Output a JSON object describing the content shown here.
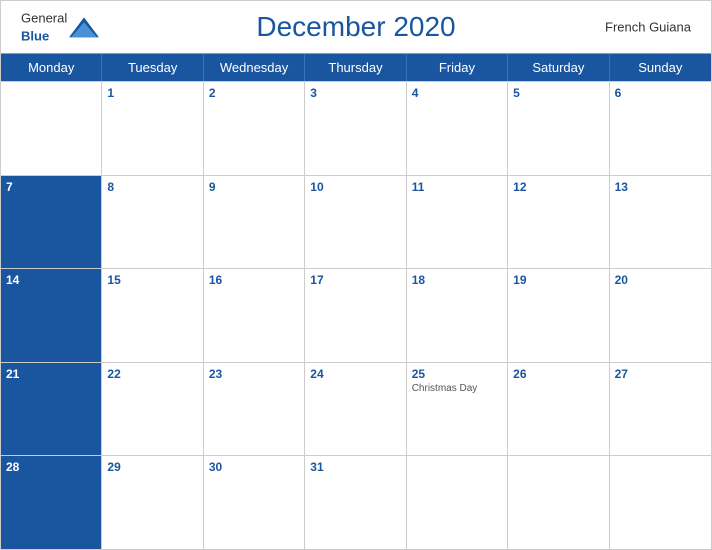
{
  "header": {
    "logo_general": "General",
    "logo_blue": "Blue",
    "title": "December 2020",
    "region": "French Guiana"
  },
  "dayHeaders": [
    "Monday",
    "Tuesday",
    "Wednesday",
    "Thursday",
    "Friday",
    "Saturday",
    "Sunday"
  ],
  "weeks": [
    [
      {
        "num": "",
        "empty": true
      },
      {
        "num": "1"
      },
      {
        "num": "2"
      },
      {
        "num": "3"
      },
      {
        "num": "4"
      },
      {
        "num": "5"
      },
      {
        "num": "6"
      }
    ],
    [
      {
        "num": "7"
      },
      {
        "num": "8"
      },
      {
        "num": "9"
      },
      {
        "num": "10"
      },
      {
        "num": "11"
      },
      {
        "num": "12"
      },
      {
        "num": "13"
      }
    ],
    [
      {
        "num": "14"
      },
      {
        "num": "15"
      },
      {
        "num": "16"
      },
      {
        "num": "17"
      },
      {
        "num": "18"
      },
      {
        "num": "19"
      },
      {
        "num": "20"
      }
    ],
    [
      {
        "num": "21"
      },
      {
        "num": "22"
      },
      {
        "num": "23"
      },
      {
        "num": "24"
      },
      {
        "num": "25",
        "holiday": "Christmas Day"
      },
      {
        "num": "26"
      },
      {
        "num": "27"
      }
    ],
    [
      {
        "num": "28"
      },
      {
        "num": "29"
      },
      {
        "num": "30"
      },
      {
        "num": "31"
      },
      {
        "num": "",
        "empty": true
      },
      {
        "num": "",
        "empty": true
      },
      {
        "num": "",
        "empty": true
      }
    ]
  ]
}
